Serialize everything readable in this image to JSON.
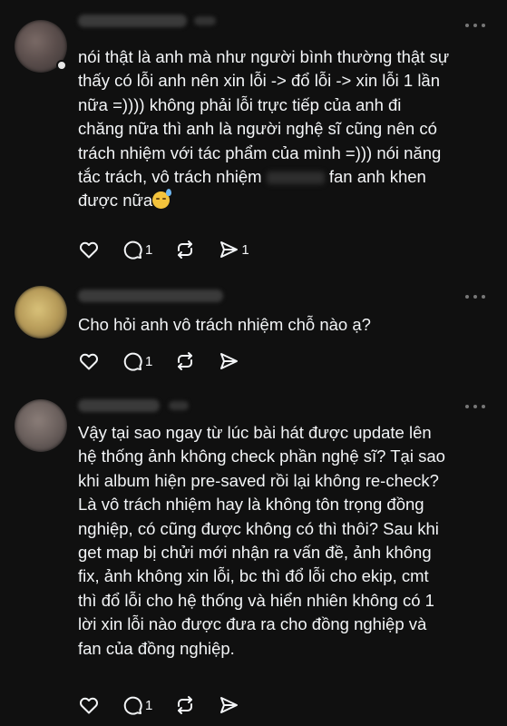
{
  "posts": [
    {
      "lines": [
        "nói thật là anh mà như người bình thường thật sự",
        "thấy có lỗi anh nên xin lỗi -> đổ lỗi -> xin lỗi 1 lần",
        "nữa =)))) không phải lỗi trực tiếp của anh đi",
        "chăng nữa thì anh là người nghệ sĩ cũng nên có",
        "trách nhiệm với tác phẩm của mình =))) nói năng"
      ],
      "line6_before": "tắc trách, vô trách nhiệm",
      "line6_after": "fan anh khen",
      "line7": "được nữa",
      "reply_count": "1",
      "share_count": "1"
    },
    {
      "lines": [
        "Cho hỏi anh vô trách nhiệm chỗ nào ạ?"
      ],
      "reply_count": "1"
    },
    {
      "lines": [
        "Vậy tại sao ngay từ lúc bài hát được update lên",
        "hệ thống ảnh không check phần nghệ sĩ? Tại sao",
        "khi album hiện pre-saved rồi lại không re-check?",
        "Là vô trách nhiệm hay là không tôn trọng đồng",
        "nghiệp, có cũng được không có thì thôi? Sau khi",
        "get map bị chửi mới nhận ra vấn đề, ảnh không",
        "fix, ảnh không xin lỗi, bc thì đổ lỗi cho ekip, cmt",
        "thì đổ lỗi cho hệ thống và hiển nhiên không có 1",
        "lời xin lỗi nào được đưa ra cho đồng nghiệp và",
        "fan của đồng nghiệp."
      ],
      "reply_count": "1"
    }
  ],
  "icons": {
    "like": "heart-icon",
    "reply": "comment-icon",
    "repost": "repost-icon",
    "share": "send-icon",
    "more": "more-dots-icon",
    "emoji": "downcast-sweat-emoji"
  },
  "colors": {
    "background": "#101010",
    "text": "#f3f5f7",
    "muted": "#777777"
  }
}
